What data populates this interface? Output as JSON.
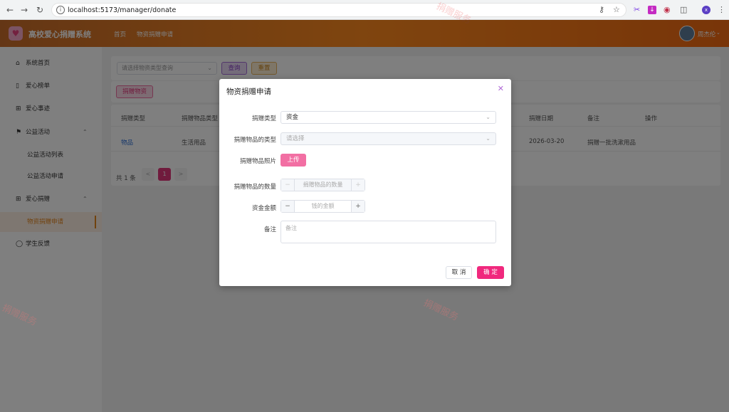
{
  "browser": {
    "url": "localhost:5173/manager/donate"
  },
  "header": {
    "logo_text": "高校爱心捐赠系统",
    "crumbs": [
      "首页",
      "物资捐赠申请"
    ],
    "username": "周杰伦"
  },
  "sidebar": {
    "items": [
      {
        "label": "系统首页",
        "icon": "home-icon"
      },
      {
        "label": "爱心榜单",
        "icon": "bookmark-icon"
      },
      {
        "label": "爱心事迹",
        "icon": "plus-box-icon"
      },
      {
        "label": "公益活动",
        "icon": "flag-icon"
      },
      {
        "label": "公益活动列表"
      },
      {
        "label": "公益活动申请"
      },
      {
        "label": "爱心捐赠",
        "icon": "plus-box-icon"
      },
      {
        "label": "物资捐赠申请"
      },
      {
        "label": "学生反馈",
        "icon": "chat-icon"
      }
    ]
  },
  "toolbar": {
    "select_placeholder": "请选择物资类型查询",
    "query_label": "查询",
    "reset_label": "重置",
    "donate_label": "捐赠物资"
  },
  "table": {
    "headers": [
      "捐赠类型",
      "捐赠物品类型",
      "捐赠日期",
      "备注",
      "操作"
    ],
    "row": {
      "type": "物品",
      "item_type": "生活用品",
      "date": "2026-03-20",
      "note": "捐赠一批洗漱用品"
    }
  },
  "pagination": {
    "total": "共 1 条",
    "prev": "<",
    "page": "1",
    "next": ">"
  },
  "watermarks": [
    "捐赠服务",
    "捐赠服务",
    "捐赠服务"
  ],
  "dialog": {
    "title": "物资捐赠申请",
    "fields": {
      "donate_type_label": "捐赠类型",
      "donate_type_value": "资金",
      "item_type_label": "捐赠物品的类型",
      "item_type_placeholder": "请选择",
      "photo_label": "捐赠物品照片",
      "upload_label": "上传",
      "quantity_label": "捐赠物品的数量",
      "quantity_placeholder": "捐赠物品的数量",
      "amount_label": "资金金额",
      "amount_placeholder": "钱的金额",
      "note_label": "备注",
      "note_placeholder": "备注"
    },
    "cancel_label": "取 消",
    "ok_label": "确 定"
  }
}
